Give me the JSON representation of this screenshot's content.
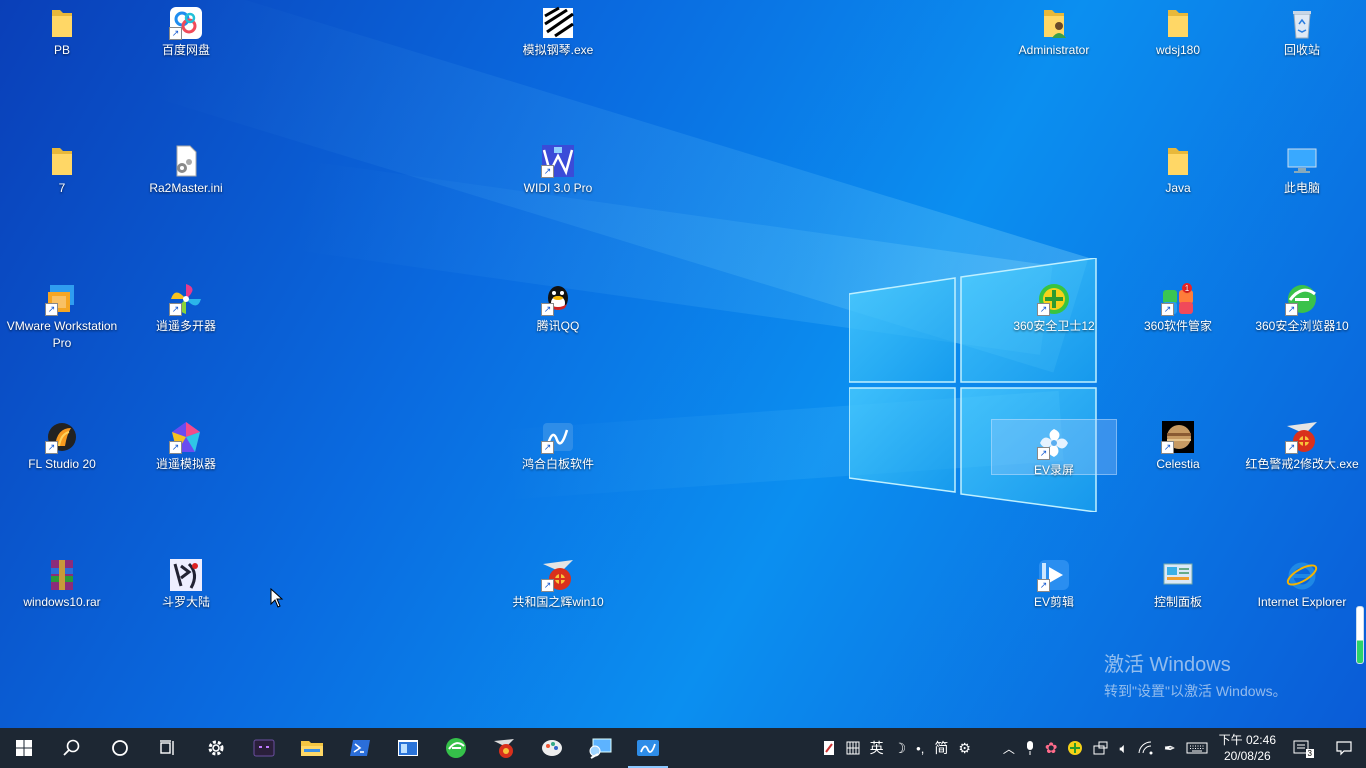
{
  "desktop_icons": [
    {
      "id": "pb",
      "label": "PB",
      "kind": "folder",
      "col": 0,
      "row": 0
    },
    {
      "id": "baidu",
      "label": "百度网盘",
      "kind": "baidu",
      "col": 1,
      "row": 0,
      "shortcut": true
    },
    {
      "id": "piano",
      "label": "模拟钢琴.exe",
      "kind": "piano",
      "col": 4,
      "row": 0
    },
    {
      "id": "admin",
      "label": "Administrator",
      "kind": "userfolder",
      "col": 8,
      "row": 0
    },
    {
      "id": "wdsj",
      "label": "wdsj180",
      "kind": "folder",
      "col": 9,
      "row": 0
    },
    {
      "id": "recycle",
      "label": "回收站",
      "kind": "recycle",
      "col": 10,
      "row": 0
    },
    {
      "id": "seven",
      "label": "7",
      "kind": "folder",
      "col": 0,
      "row": 1
    },
    {
      "id": "ra2",
      "label": "Ra2Master.ini",
      "kind": "inifile",
      "col": 1,
      "row": 1
    },
    {
      "id": "widi",
      "label": "WIDI 3.0 Pro",
      "kind": "widi",
      "col": 4,
      "row": 1,
      "shortcut": true
    },
    {
      "id": "java",
      "label": "Java",
      "kind": "folder",
      "col": 9,
      "row": 1
    },
    {
      "id": "thispc",
      "label": "此电脑",
      "kind": "pc",
      "col": 10,
      "row": 1
    },
    {
      "id": "vmware",
      "label": "VMware Workstation Pro",
      "kind": "vmware",
      "col": 0,
      "row": 2,
      "shortcut": true
    },
    {
      "id": "xiaoyao",
      "label": "逍遥多开器",
      "kind": "pinwheel",
      "col": 1,
      "row": 2,
      "shortcut": true
    },
    {
      "id": "qq",
      "label": "腾讯QQ",
      "kind": "qq",
      "col": 4,
      "row": 2,
      "shortcut": true
    },
    {
      "id": "safe360",
      "label": "360安全卫士12",
      "kind": "safe360",
      "col": 8,
      "row": 2,
      "shortcut": true
    },
    {
      "id": "soft360",
      "label": "360软件管家",
      "kind": "soft360",
      "col": 9,
      "row": 2,
      "shortcut": true
    },
    {
      "id": "browser360",
      "label": "360安全浏览器10",
      "kind": "browser360",
      "col": 10,
      "row": 2,
      "shortcut": true
    },
    {
      "id": "fl",
      "label": "FL Studio 20",
      "kind": "fl",
      "col": 0,
      "row": 3,
      "shortcut": true
    },
    {
      "id": "xiaoyaosim",
      "label": "逍遥模拟器",
      "kind": "gem",
      "col": 1,
      "row": 3,
      "shortcut": true
    },
    {
      "id": "honghe",
      "label": "鸿合白板软件",
      "kind": "whiteboard",
      "col": 4,
      "row": 3,
      "shortcut": true
    },
    {
      "id": "evrec",
      "label": "EV录屏",
      "kind": "evrec",
      "col": 8,
      "row": 3,
      "shortcut": true,
      "selected": true
    },
    {
      "id": "celestia",
      "label": "Celestia",
      "kind": "celestia",
      "col": 9,
      "row": 3,
      "shortcut": true
    },
    {
      "id": "ra2mod",
      "label": "红色警戒2修改大.exe",
      "kind": "ra2",
      "col": 10,
      "row": 3,
      "shortcut": true
    },
    {
      "id": "rar",
      "label": "windows10.rar",
      "kind": "rar",
      "col": 0,
      "row": 4
    },
    {
      "id": "douluo",
      "label": "斗罗大陆",
      "kind": "douluo",
      "col": 1,
      "row": 4
    },
    {
      "id": "gonghe",
      "label": "共和国之辉win10",
      "kind": "ra2",
      "col": 4,
      "row": 4,
      "shortcut": true
    },
    {
      "id": "evedit",
      "label": "EV剪辑",
      "kind": "evedit",
      "col": 8,
      "row": 4,
      "shortcut": true
    },
    {
      "id": "control",
      "label": "控制面板",
      "kind": "control",
      "col": 9,
      "row": 4
    },
    {
      "id": "ie",
      "label": "Internet Explorer",
      "kind": "ie",
      "col": 10,
      "row": 4
    }
  ],
  "watermark": {
    "line1": "激活 Windows",
    "line2": "转到\"设置\"以激活 Windows。"
  },
  "taskbar": {
    "items": [
      "start-icon",
      "search-icon",
      "cortana-icon",
      "task-view-icon",
      "settings-icon",
      "terminal-app-icon",
      "file-explorer-icon",
      "powershell-icon",
      "window-app-icon",
      "browser-360-icon",
      "ra2-app-icon",
      "paint-app-icon",
      "remote-desktop-icon",
      "whiteboard-app-icon"
    ],
    "active": "whiteboard-app-icon"
  },
  "tray": {
    "ime_items": [
      "ime-pen-icon",
      "ime-grid-icon",
      "英",
      "ime-moon-icon",
      "ime-punct-icon",
      "简",
      "ime-settings-icon"
    ],
    "lang_label": "英",
    "simplified_label": "简",
    "time": "下午 02:46",
    "date": "20/08/26",
    "notification_count": "3"
  }
}
